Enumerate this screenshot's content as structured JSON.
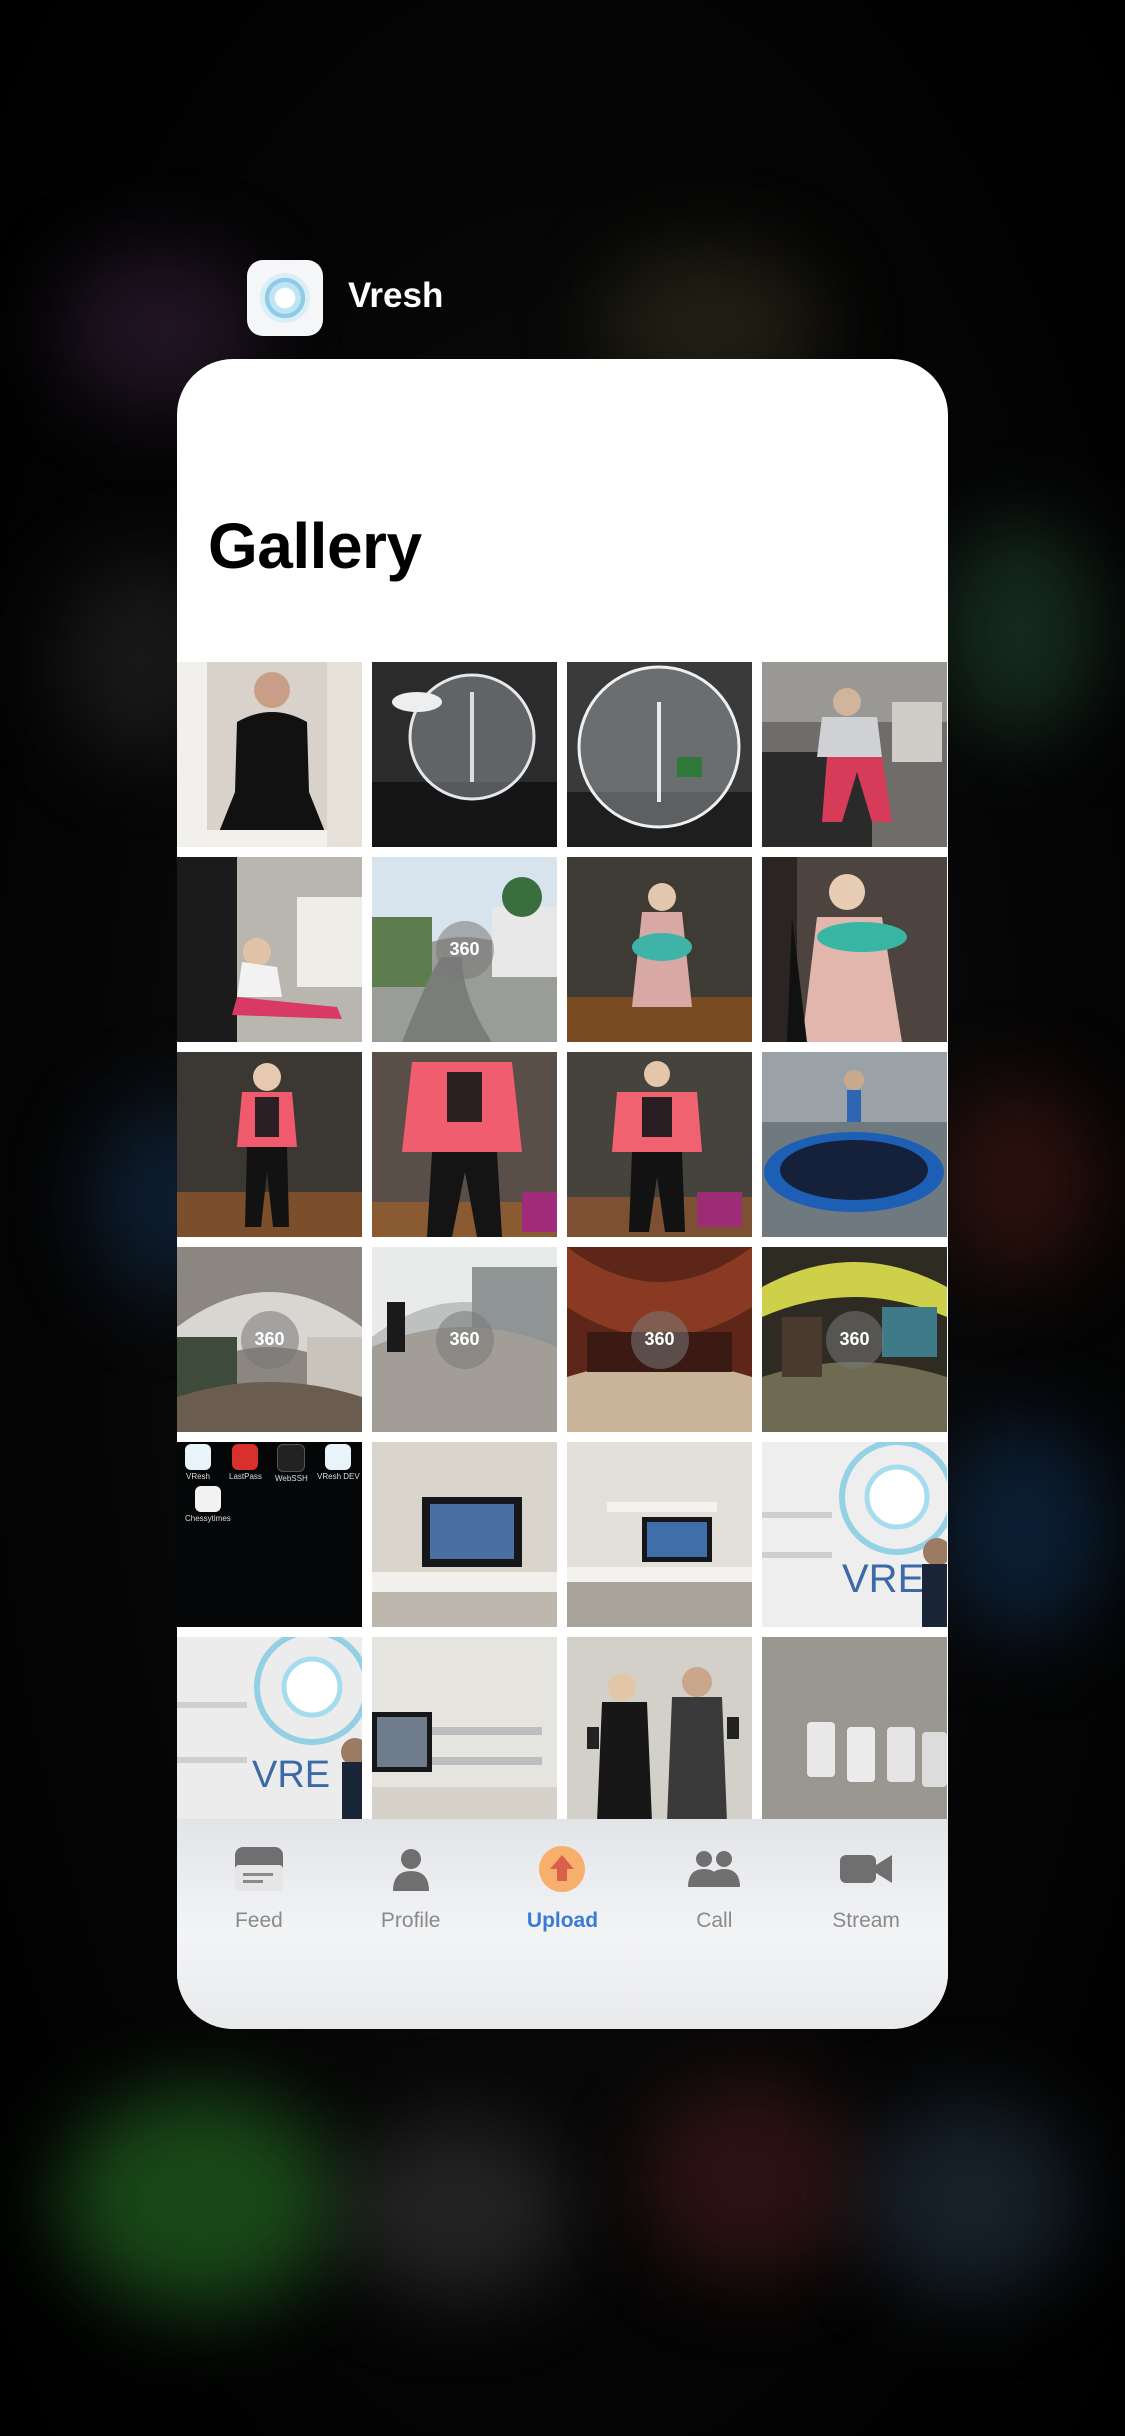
{
  "app": {
    "name": "Vresh",
    "icon": "vresh-app-icon"
  },
  "page": {
    "title": "Gallery"
  },
  "gallery": {
    "thumbnails": [
      {
        "badge": "",
        "desc": "girl-black-dress"
      },
      {
        "badge": "",
        "desc": "glass-globe-1"
      },
      {
        "badge": "",
        "desc": "glass-globe-2"
      },
      {
        "badge": "",
        "desc": "girl-pink-pants"
      },
      {
        "badge": "",
        "desc": "girl-chair"
      },
      {
        "badge": "360",
        "desc": "street-360"
      },
      {
        "badge": "",
        "desc": "girl-unicorn-1"
      },
      {
        "badge": "",
        "desc": "girl-unicorn-2"
      },
      {
        "badge": "",
        "desc": "girl-pink-jacket-1"
      },
      {
        "badge": "",
        "desc": "girl-pink-jacket-2"
      },
      {
        "badge": "",
        "desc": "girl-pink-jacket-3"
      },
      {
        "badge": "",
        "desc": "trampoline"
      },
      {
        "badge": "360",
        "desc": "room-360-1"
      },
      {
        "badge": "360",
        "desc": "gate-360"
      },
      {
        "badge": "360",
        "desc": "red-room-360"
      },
      {
        "badge": "360",
        "desc": "room-360-2"
      },
      {
        "badge": "",
        "desc": "homescreen"
      },
      {
        "badge": "",
        "desc": "tv-wall-1"
      },
      {
        "badge": "",
        "desc": "tv-wall-2"
      },
      {
        "badge": "",
        "desc": "vresh-logo-wall-1"
      },
      {
        "badge": "",
        "desc": "vresh-logo-wall-2"
      },
      {
        "badge": "",
        "desc": "tv-wall-3"
      },
      {
        "badge": "",
        "desc": "two-people-phones"
      },
      {
        "badge": "",
        "desc": "phones-on-carpet"
      }
    ],
    "homescreen_apps": [
      "VResh",
      "LastPass",
      "WebSSH",
      "VResh DEV",
      "Chessytimes"
    ]
  },
  "tabbar": {
    "items": [
      {
        "label": "Feed",
        "icon": "feed-icon"
      },
      {
        "label": "Profile",
        "icon": "profile-icon"
      },
      {
        "label": "Upload",
        "icon": "upload-icon"
      },
      {
        "label": "Call",
        "icon": "call-icon"
      },
      {
        "label": "Stream",
        "icon": "stream-icon"
      }
    ],
    "active": "Upload"
  },
  "colors": {
    "accent": "#3a7bd5",
    "inactive": "#8a8a8a",
    "upload_circle": "#f5a35c"
  }
}
